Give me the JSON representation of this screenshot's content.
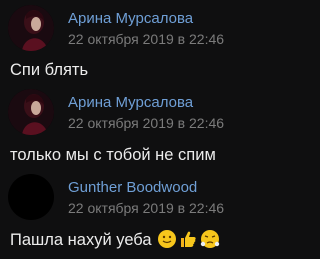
{
  "messages": [
    {
      "author": "Арина Мурсалова",
      "date": "22 октября 2019 в 22:46",
      "text": "Спи блять",
      "avatar": "arina-avatar"
    },
    {
      "author": "Арина Мурсалова",
      "date": "22 октября 2019 в 22:46",
      "text": "только мы с тобой не спим",
      "avatar": "arina-avatar"
    },
    {
      "author": "Gunther Boodwood",
      "date": "22 октября 2019 в 22:46",
      "text": "Пашла нахуй уеба",
      "avatar": "black-avatar",
      "emojis": [
        "slightly-smiling-face",
        "thumbs-up",
        "face-with-steam"
      ]
    }
  ],
  "colors": {
    "background": "#0f0f10",
    "author": "#6f9fd6",
    "date": "#7b7b7b",
    "text": "#ececec"
  }
}
